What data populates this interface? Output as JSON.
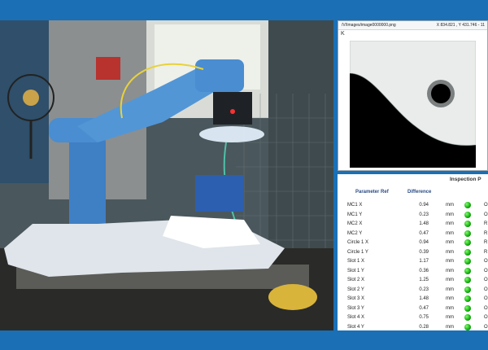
{
  "viewer": {
    "path": "/V/Images/image0000000.png",
    "coords": "X 834.821 , Y 431.746 - 11",
    "tool_glyph": "K"
  },
  "inspection": {
    "title": "Inspection P",
    "headers": {
      "parameter": "Parameter Ref",
      "difference": "Difference"
    },
    "rows": [
      {
        "param": "MC1 X",
        "value": "0.94",
        "unit": "mm",
        "status": "O"
      },
      {
        "param": "MC1 Y",
        "value": "0.23",
        "unit": "mm",
        "status": "O"
      },
      {
        "param": "MC2 X",
        "value": "1.48",
        "unit": "mm",
        "status": "R"
      },
      {
        "param": "MC2 Y",
        "value": "0.47",
        "unit": "mm",
        "status": "R"
      },
      {
        "param": "Circle 1 X",
        "value": "0.94",
        "unit": "mm",
        "status": "R"
      },
      {
        "param": "Circle 1 Y",
        "value": "0.39",
        "unit": "mm",
        "status": "R"
      },
      {
        "param": "Slot 1 X",
        "value": "1.17",
        "unit": "mm",
        "status": "O"
      },
      {
        "param": "Slot 1 Y",
        "value": "0.36",
        "unit": "mm",
        "status": "O"
      },
      {
        "param": "Slot 2 X",
        "value": "1.25",
        "unit": "mm",
        "status": "O"
      },
      {
        "param": "Slot 2 Y",
        "value": "0.23",
        "unit": "mm",
        "status": "O"
      },
      {
        "param": "Slot 3 X",
        "value": "1.48",
        "unit": "mm",
        "status": "O"
      },
      {
        "param": "Slot 3 Y",
        "value": "0.47",
        "unit": "mm",
        "status": "O"
      },
      {
        "param": "Slot 4 X",
        "value": "0.75",
        "unit": "mm",
        "status": "O"
      },
      {
        "param": "Slot 4 Y",
        "value": "0.28",
        "unit": "mm",
        "status": "O"
      }
    ]
  },
  "colors": {
    "frame_blue": "#1a6fb5",
    "header_blue": "#2b4b86",
    "status_green": "#11a80b",
    "robot_blue": "#3f7fc4"
  }
}
